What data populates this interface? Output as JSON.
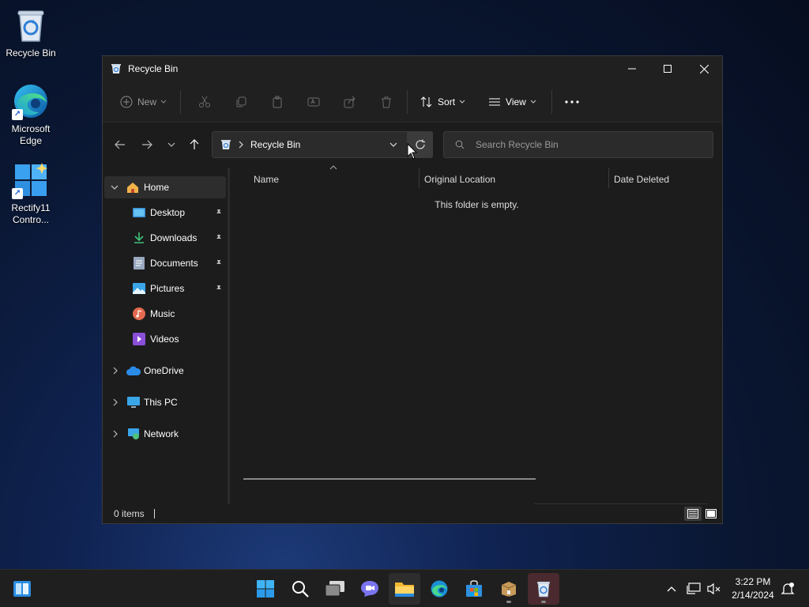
{
  "desktop": {
    "icons": [
      {
        "label": "Recycle Bin"
      },
      {
        "label": "Microsoft Edge"
      },
      {
        "label": "Rectify11 Contro..."
      }
    ]
  },
  "window": {
    "title": "Recycle Bin",
    "command_bar": {
      "new_label": "New",
      "sort_label": "Sort",
      "view_label": "View"
    },
    "address": {
      "location": "Recycle Bin"
    },
    "search": {
      "placeholder": "Search Recycle Bin"
    },
    "nav": {
      "home": "Home",
      "quick_access": [
        {
          "label": "Desktop"
        },
        {
          "label": "Downloads"
        },
        {
          "label": "Documents"
        },
        {
          "label": "Pictures"
        },
        {
          "label": "Music"
        },
        {
          "label": "Videos"
        }
      ],
      "onedrive": "OneDrive",
      "this_pc": "This PC",
      "network": "Network"
    },
    "columns": [
      "Name",
      "Original Location",
      "Date Deleted"
    ],
    "empty_message": "This folder is empty.",
    "status": "0 items"
  },
  "taskbar": {
    "time": "3:22 PM",
    "date": "2/14/2024"
  },
  "colors": {
    "accent": "#4cc2ff",
    "window_bg": "#1c1c1c",
    "selection": "#2d2d2d"
  }
}
